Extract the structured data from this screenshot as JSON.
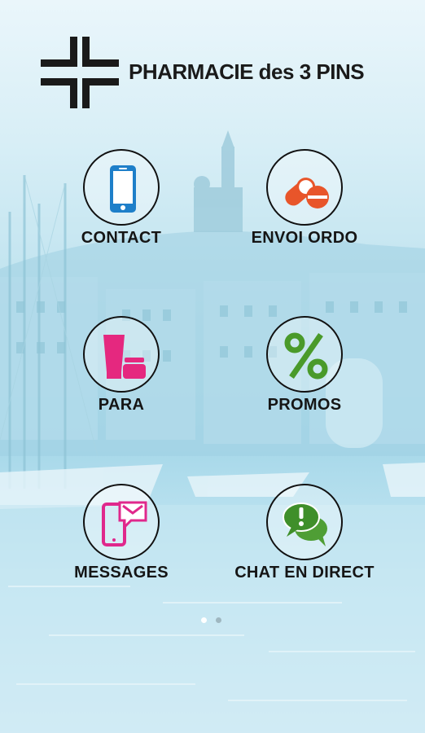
{
  "header": {
    "brand": "PHARMACIE des 3 PINS",
    "logo_icon": "pharmacy-cross-logo"
  },
  "tiles": [
    {
      "label": "CONTACT",
      "icon": "smartphone-icon",
      "color": "#1e7fc9"
    },
    {
      "label": "ENVOI ORDO",
      "icon": "pills-icon",
      "color": "#e8552a"
    },
    {
      "label": "PARA",
      "icon": "cosmetics-icon",
      "color": "#e5287f"
    },
    {
      "label": "PROMOS",
      "icon": "percent-icon",
      "color": "#4a9a2a"
    },
    {
      "label": "MESSAGES",
      "icon": "phone-mail-icon",
      "color": "#e0288c"
    },
    {
      "label": "CHAT EN DIRECT",
      "icon": "chat-bubbles-icon",
      "color": "#3f8f2a"
    }
  ],
  "pager": {
    "pages": 2,
    "current": 1
  },
  "colors": {
    "background": "#bfe4f0",
    "text": "#151515"
  }
}
